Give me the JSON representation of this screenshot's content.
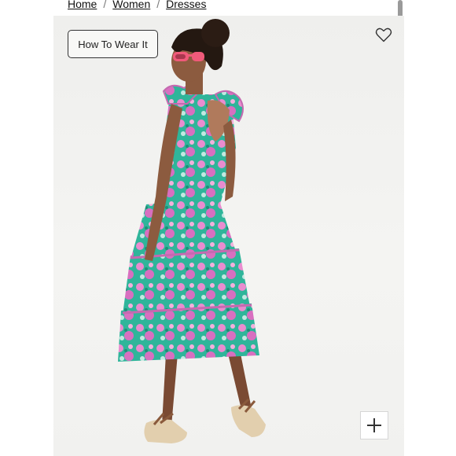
{
  "breadcrumb": {
    "items": [
      "Home",
      "Women",
      "Dresses"
    ],
    "separator": "/"
  },
  "product_image": {
    "how_to_wear_label": "How To Wear It",
    "wishlist_icon": "heart-outline-icon",
    "zoom_icon": "plus-icon"
  },
  "colors": {
    "dress_green": "#2fb59a",
    "dress_pink": "#e98ccf",
    "sunglasses": "#f05a7a"
  }
}
